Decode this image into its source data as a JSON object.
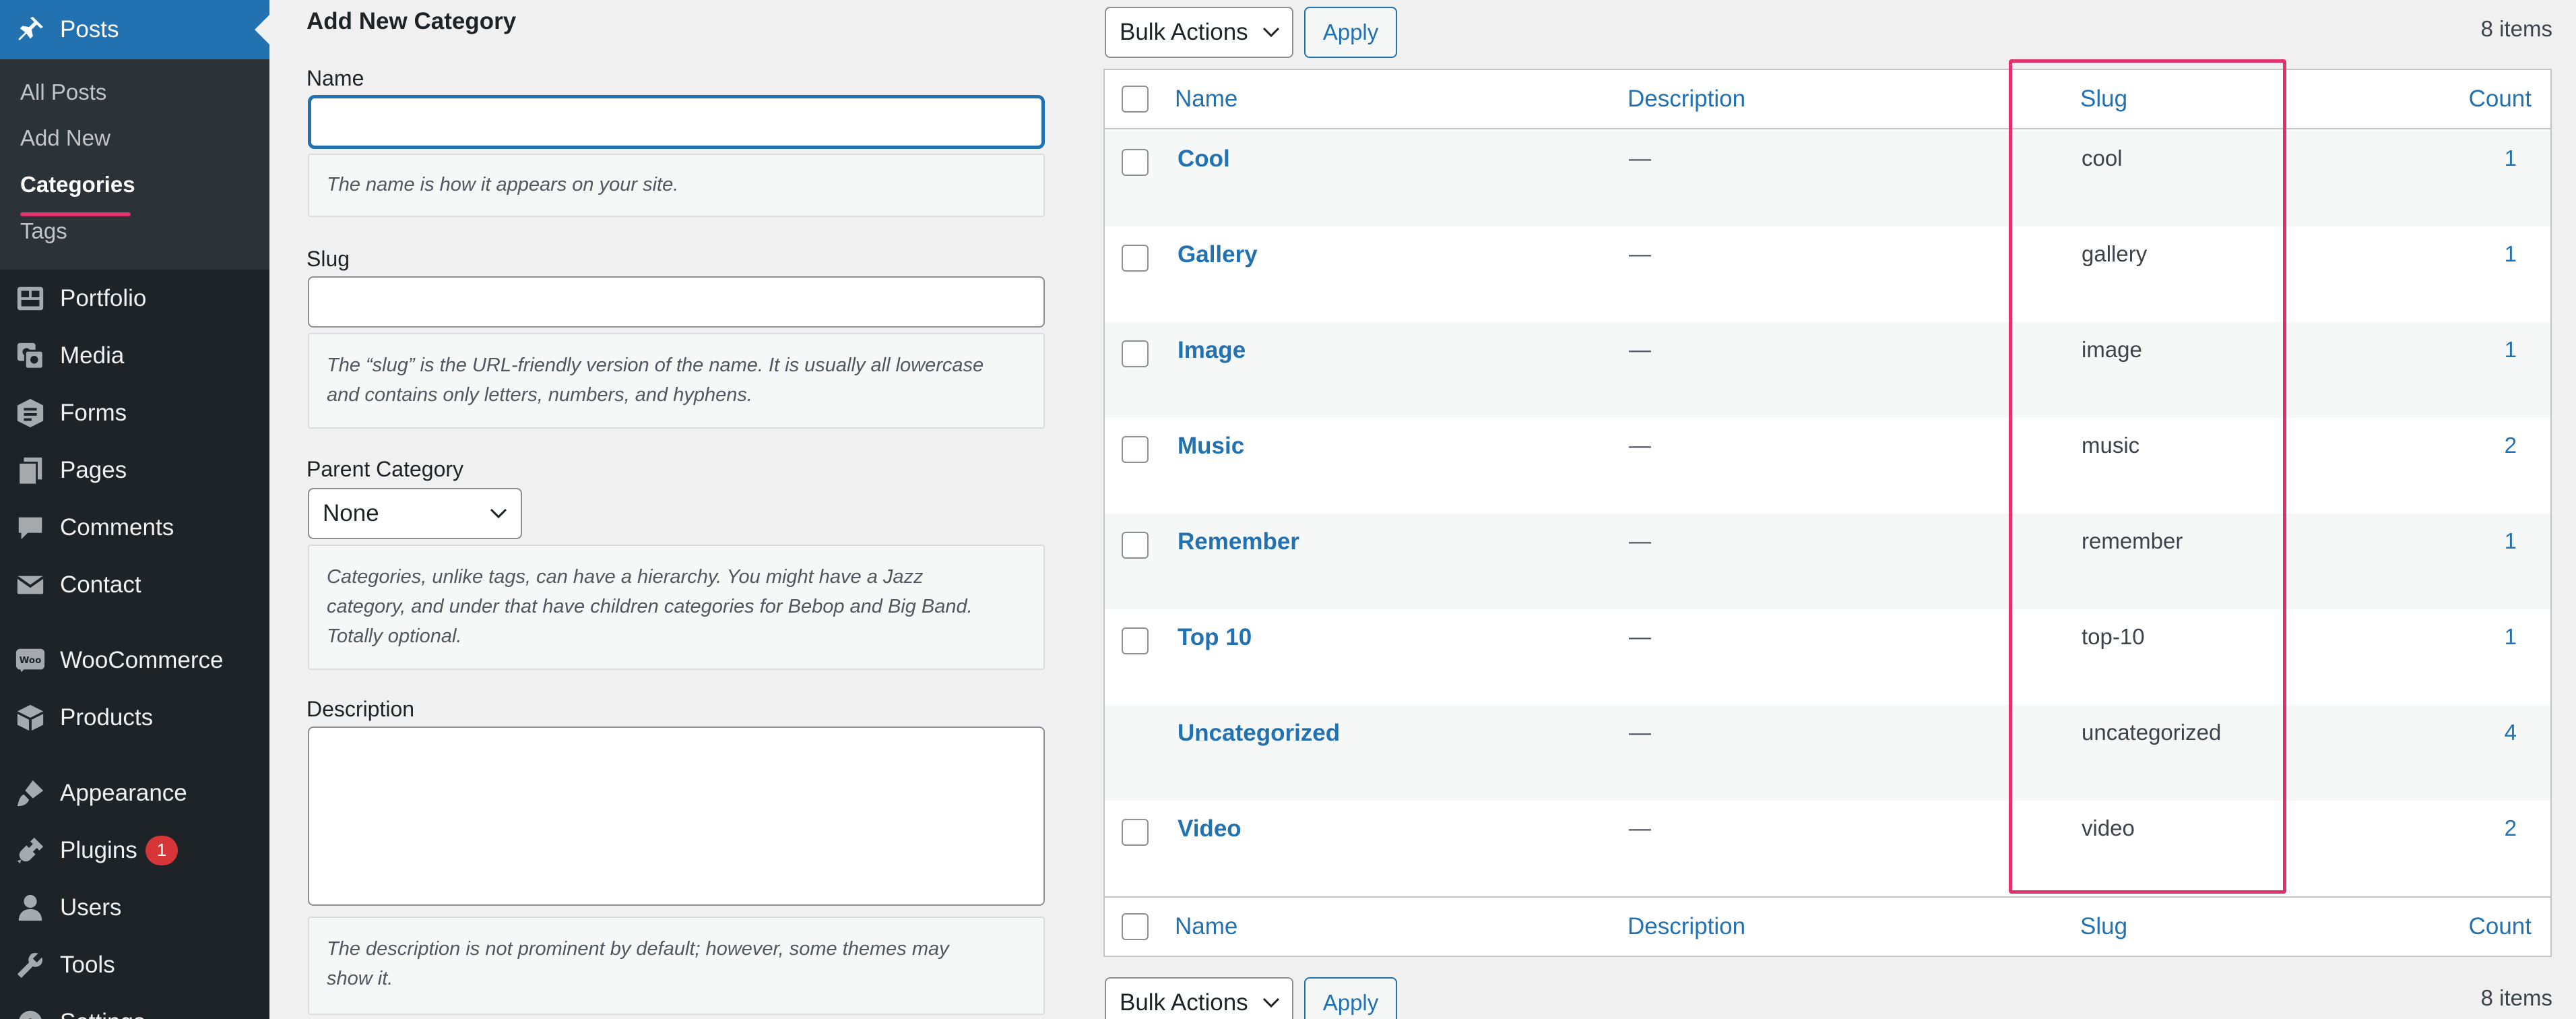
{
  "sidebar": {
    "posts_label": "Posts",
    "submenu": [
      "All Posts",
      "Add New",
      "Categories",
      "Tags"
    ],
    "items": [
      {
        "label": "Portfolio",
        "icon": "portfolio-icon"
      },
      {
        "label": "Media",
        "icon": "media-icon"
      },
      {
        "label": "Forms",
        "icon": "forms-icon"
      },
      {
        "label": "Pages",
        "icon": "pages-icon"
      },
      {
        "label": "Comments",
        "icon": "comments-icon"
      },
      {
        "label": "Contact",
        "icon": "contact-icon"
      },
      {
        "label": "WooCommerce",
        "icon": "woocommerce-icon"
      },
      {
        "label": "Products",
        "icon": "products-icon"
      },
      {
        "label": "Appearance",
        "icon": "appearance-icon"
      },
      {
        "label": "Plugins",
        "icon": "plugins-icon",
        "badge": "1"
      },
      {
        "label": "Users",
        "icon": "users-icon"
      },
      {
        "label": "Tools",
        "icon": "tools-icon"
      },
      {
        "label": "Settings",
        "icon": "settings-icon"
      }
    ]
  },
  "form": {
    "title": "Add New Category",
    "name_label": "Name",
    "name_value": "",
    "name_help": "The name is how it appears on your site.",
    "slug_label": "Slug",
    "slug_value": "",
    "slug_help_1": "The “slug” is the URL-friendly version of the name. It is usually all lowercase",
    "slug_help_2": "and contains only letters, numbers, and hyphens.",
    "parent_label": "Parent Category",
    "parent_value": "None",
    "parent_help_1": "Categories, unlike tags, can have a hierarchy. You might have a Jazz",
    "parent_help_2": "category, and under that have children categories for Bebop and Big Band.",
    "parent_help_3": "Totally optional.",
    "description_label": "Description",
    "description_value": "",
    "description_help_1": "The description is not prominent by default; however, some themes may",
    "description_help_2": "show it."
  },
  "table": {
    "bulk_actions": "Bulk Actions",
    "apply": "Apply",
    "items_count": "8 items",
    "columns": {
      "name": "Name",
      "description": "Description",
      "slug": "Slug",
      "count": "Count"
    },
    "rows": [
      {
        "name": "Cool",
        "description": "—",
        "slug": "cool",
        "count": "1",
        "checkbox": true
      },
      {
        "name": "Gallery",
        "description": "—",
        "slug": "gallery",
        "count": "1",
        "checkbox": true
      },
      {
        "name": "Image",
        "description": "—",
        "slug": "image",
        "count": "1",
        "checkbox": true
      },
      {
        "name": "Music",
        "description": "—",
        "slug": "music",
        "count": "2",
        "checkbox": true
      },
      {
        "name": "Remember",
        "description": "—",
        "slug": "remember",
        "count": "1",
        "checkbox": true
      },
      {
        "name": "Top 10",
        "description": "—",
        "slug": "top-10",
        "count": "1",
        "checkbox": true
      },
      {
        "name": "Uncategorized",
        "description": "—",
        "slug": "uncategorized",
        "count": "4",
        "checkbox": false
      },
      {
        "name": "Video",
        "description": "—",
        "slug": "video",
        "count": "2",
        "checkbox": true
      }
    ]
  },
  "colors": {
    "sidebar_bg": "#1d2327",
    "submenu_bg": "#2c3338",
    "accent": "#2271b1",
    "highlight": "#e0306d",
    "badge": "#d63638"
  }
}
